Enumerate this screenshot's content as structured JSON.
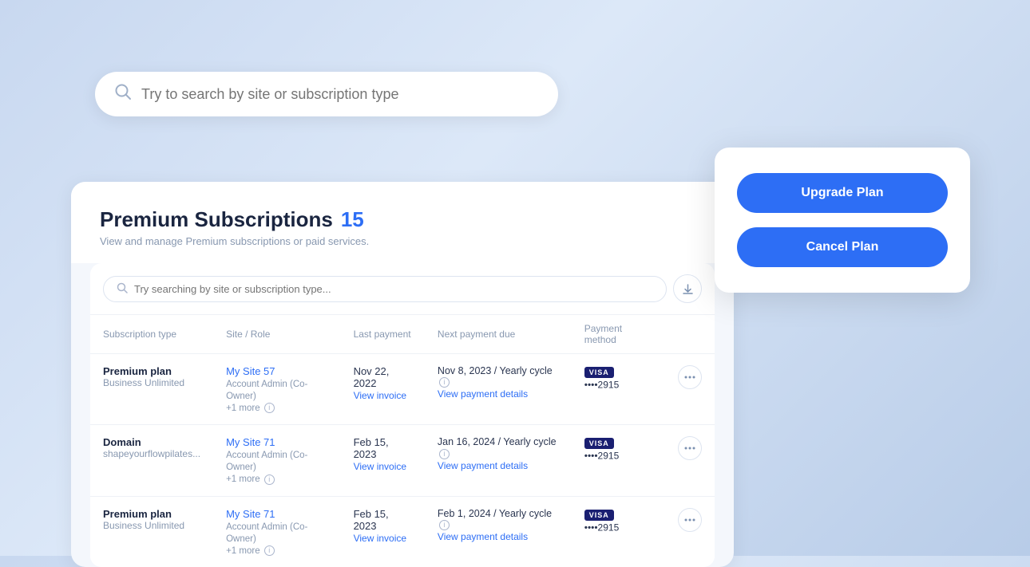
{
  "background": {
    "gradient_start": "#c8d8f0",
    "gradient_end": "#b8cce8"
  },
  "search_bar": {
    "placeholder": "Try to search by site or subscription type",
    "icon": "search-icon"
  },
  "action_card": {
    "upgrade_label": "Upgrade Plan",
    "cancel_label": "Cancel Plan"
  },
  "panel": {
    "title": "Premium Subscriptions",
    "count": "15",
    "subtitle": "View and manage Premium subscriptions or paid services.",
    "inner_search_placeholder": "Try searching by site or subscription type...",
    "table": {
      "columns": [
        "Subscription type",
        "Site / Role",
        "Last payment",
        "Next payment due",
        "Payment method"
      ],
      "rows": [
        {
          "sub_type_main": "Premium plan",
          "sub_type_sub": "Business Unlimited",
          "site_name": "My Site 57",
          "site_role": "Account Admin (Co-Owner)",
          "more": "+1 more",
          "last_payment": "Nov 22, 2022",
          "view_invoice": "View invoice",
          "next_payment": "Nov 8, 2023 / Yearly cycle",
          "view_payment": "View payment details",
          "card_brand": "VISA",
          "card_dots": "••••2915"
        },
        {
          "sub_type_main": "Domain",
          "sub_type_sub": "shapeyourflowpilates...",
          "site_name": "My Site 71",
          "site_role": "Account Admin (Co-Owner)",
          "more": "+1 more",
          "last_payment": "Feb 15, 2023",
          "view_invoice": "View invoice",
          "next_payment": "Jan 16, 2024 / Yearly cycle",
          "view_payment": "View payment details",
          "card_brand": "VISA",
          "card_dots": "••••2915"
        },
        {
          "sub_type_main": "Premium plan",
          "sub_type_sub": "Business Unlimited",
          "site_name": "My Site 71",
          "site_role": "Account Admin (Co-Owner)",
          "more": "+1 more",
          "last_payment": "Feb 15, 2023",
          "view_invoice": "View invoice",
          "next_payment": "Feb 1, 2024 / Yearly cycle",
          "view_payment": "View payment details",
          "card_brand": "VISA",
          "card_dots": "••••2915"
        }
      ]
    }
  }
}
